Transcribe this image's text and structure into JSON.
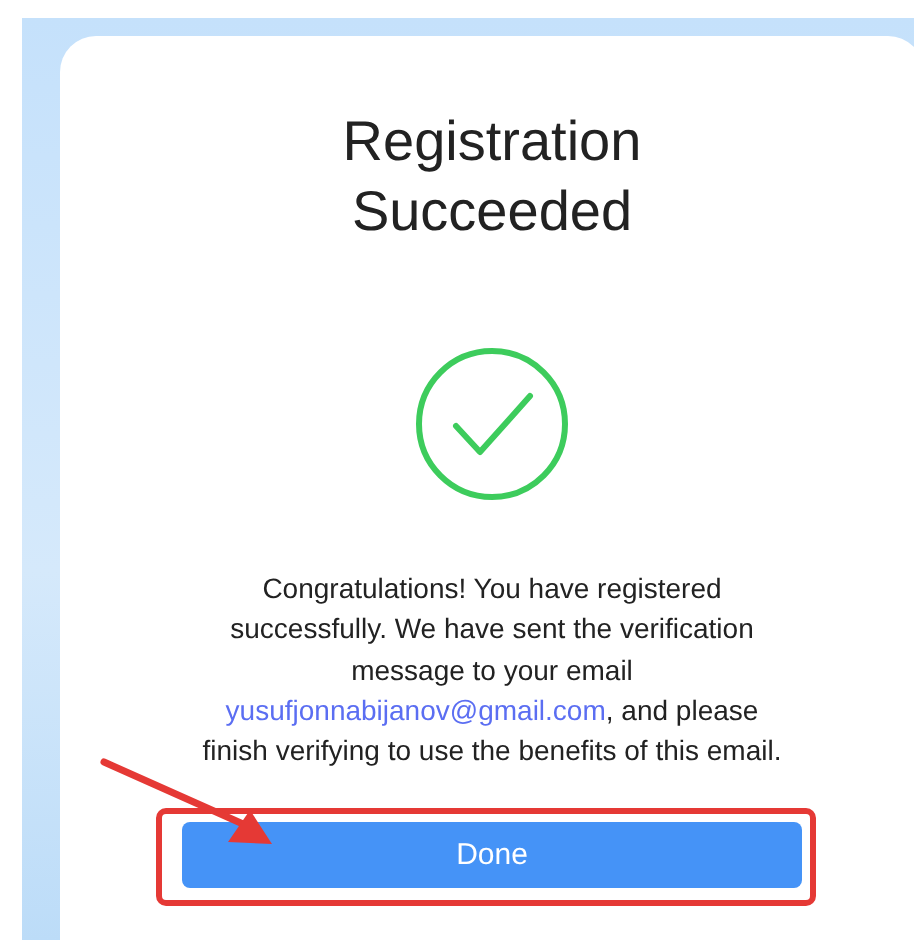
{
  "dialog": {
    "title": "Registration Succeeded",
    "message": {
      "before": "Congratulations! You have registered successfully. We have sent the verification message to your email",
      "email": "yusufjonnabijanov@gmail.com",
      "after": ", and please finish verifying to use the benefits of this email."
    },
    "button": "Done"
  }
}
